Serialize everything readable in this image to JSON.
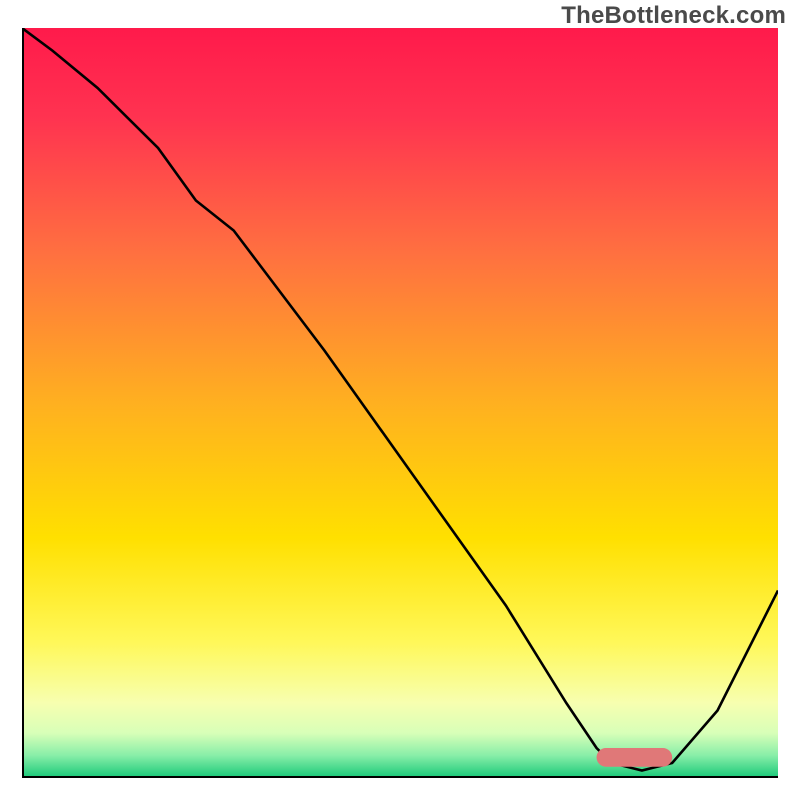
{
  "watermark": "TheBottleneck.com",
  "colors": {
    "curve_stroke": "#000000",
    "marker_fill": "#e07878",
    "axis": "#000000"
  },
  "chart_data": {
    "type": "line",
    "title": "",
    "xlabel": "",
    "ylabel": "",
    "xlim": [
      0,
      100
    ],
    "ylim": [
      0,
      100
    ],
    "x": [
      0,
      4,
      10,
      18,
      23,
      28,
      40,
      52,
      64,
      72,
      76,
      78,
      82,
      86,
      92,
      100
    ],
    "values": [
      100,
      97,
      92,
      84,
      77,
      73,
      57,
      40,
      23,
      10,
      4,
      2,
      1,
      2,
      9,
      25
    ],
    "background_gradient_stops": [
      {
        "offset": 0.0,
        "color": "#ff1a4b"
      },
      {
        "offset": 0.12,
        "color": "#ff3350"
      },
      {
        "offset": 0.3,
        "color": "#ff7040"
      },
      {
        "offset": 0.5,
        "color": "#ffb020"
      },
      {
        "offset": 0.68,
        "color": "#ffe000"
      },
      {
        "offset": 0.82,
        "color": "#fff85a"
      },
      {
        "offset": 0.9,
        "color": "#f7ffb0"
      },
      {
        "offset": 0.94,
        "color": "#d8ffb8"
      },
      {
        "offset": 0.97,
        "color": "#88eea8"
      },
      {
        "offset": 1.0,
        "color": "#18c878"
      }
    ],
    "marker": {
      "x_start": 76,
      "x_end": 86,
      "y": 1.5,
      "height": 2.5
    }
  }
}
